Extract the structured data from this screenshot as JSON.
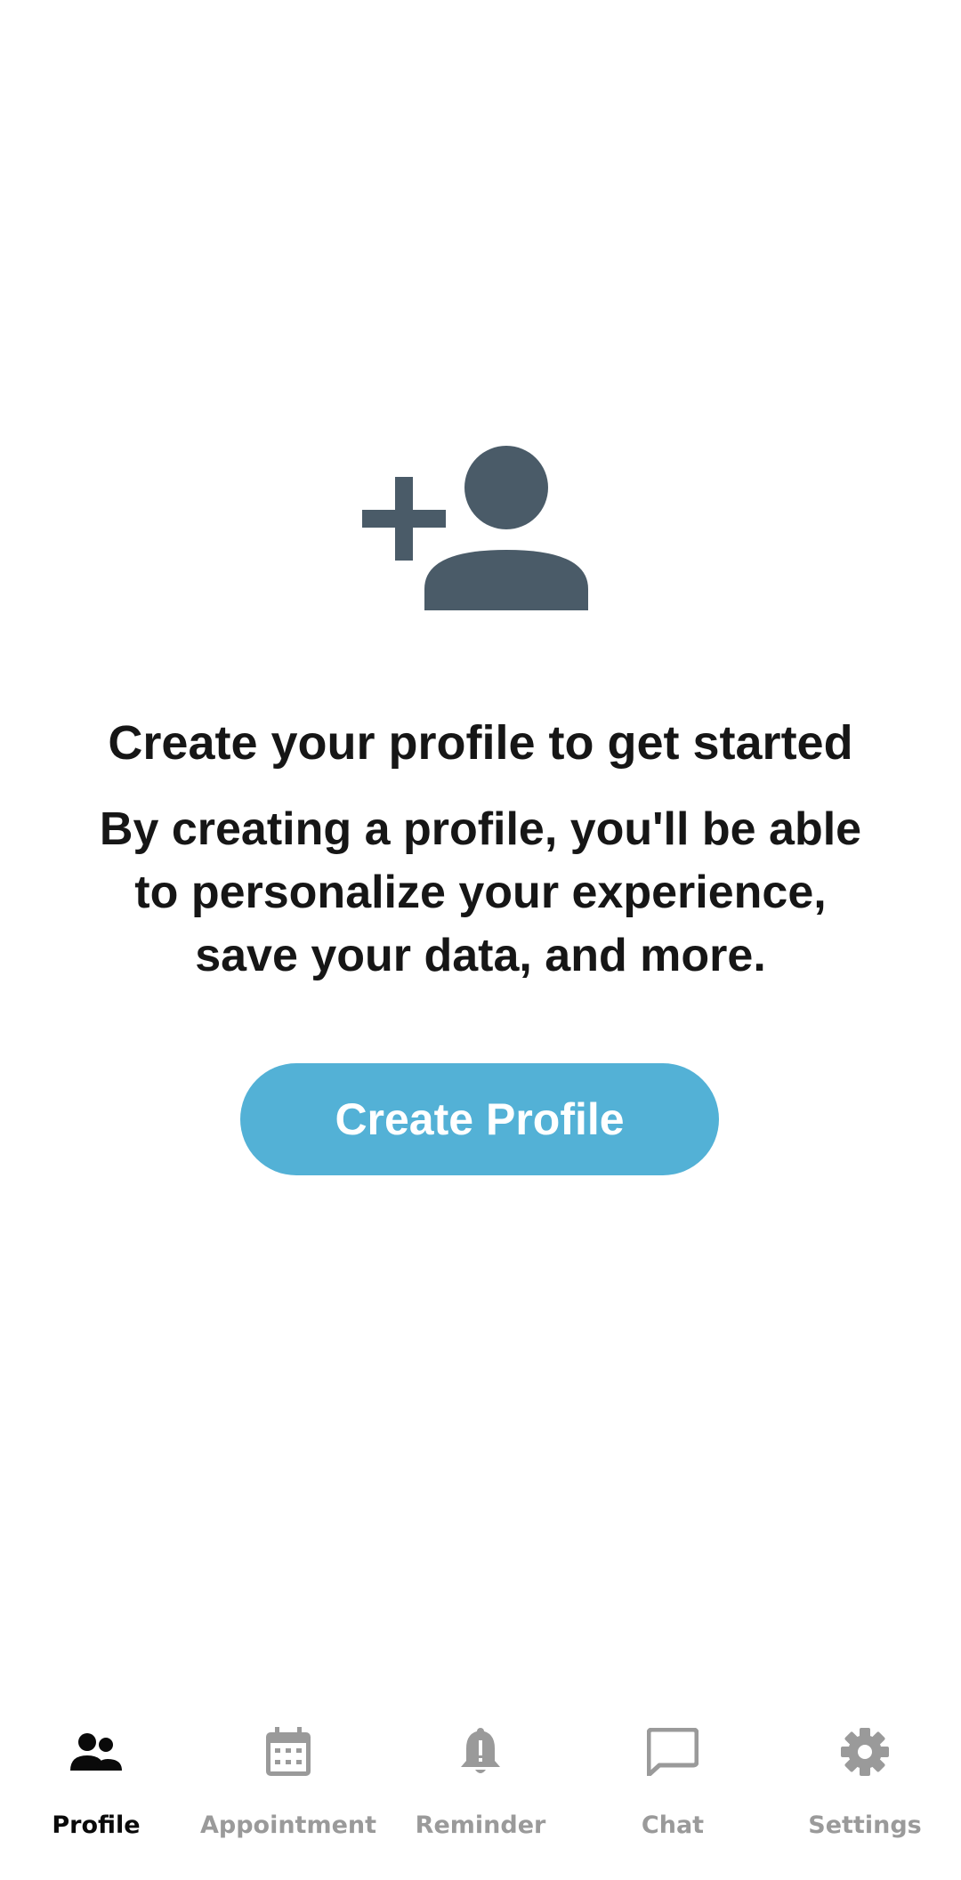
{
  "main": {
    "headline": "Create your profile to get started",
    "description": "By creating a profile, you'll be able to personalize your experience, save your data, and more.",
    "create_button_label": "Create Profile",
    "hero_icon": "person-add-icon"
  },
  "bottom_nav": {
    "items": [
      {
        "label": "Profile",
        "icon": "people-icon",
        "active": true
      },
      {
        "label": "Appointment",
        "icon": "calendar-icon",
        "active": false
      },
      {
        "label": "Reminder",
        "icon": "bell-alert-icon",
        "active": false
      },
      {
        "label": "Chat",
        "icon": "chat-icon",
        "active": false
      },
      {
        "label": "Settings",
        "icon": "gear-icon",
        "active": false
      }
    ]
  },
  "colors": {
    "accent": "#53b1d6",
    "hero_icon": "#4a5b68",
    "text_primary": "#161616",
    "nav_active": "#0a0a0a",
    "nav_inactive": "#9a9a9a"
  }
}
